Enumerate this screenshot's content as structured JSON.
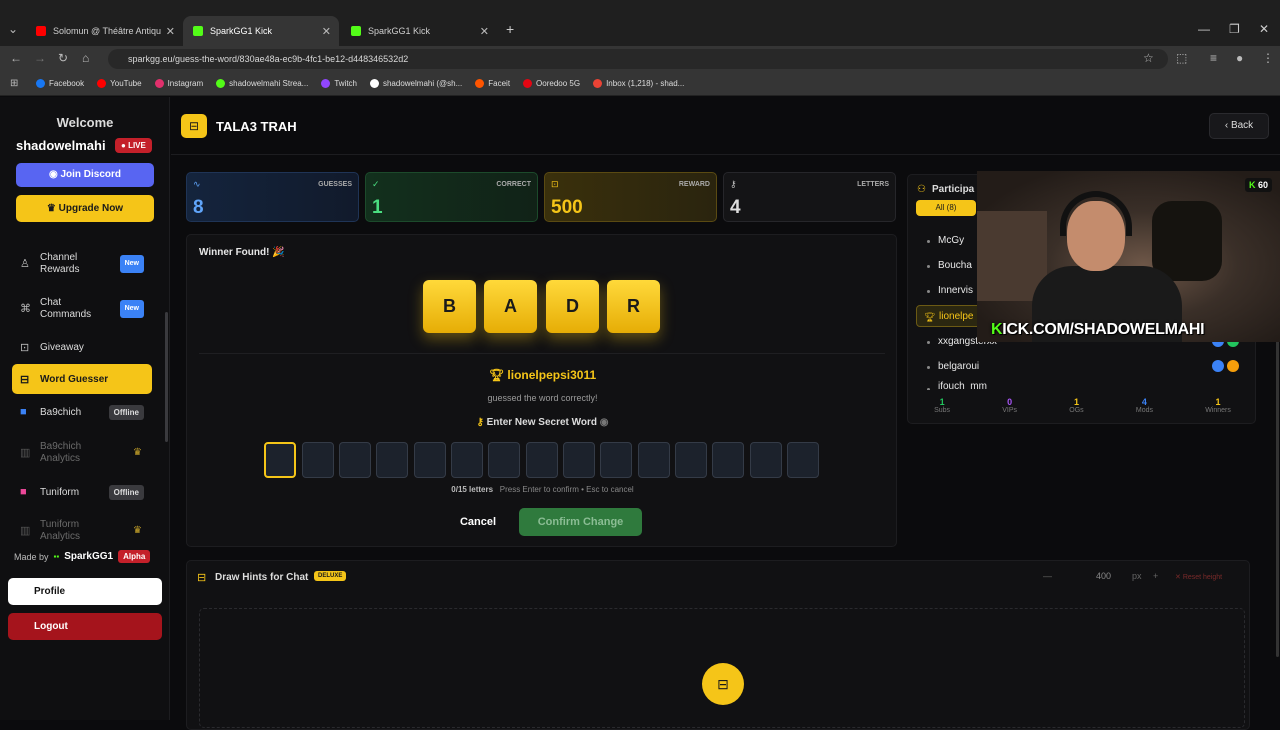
{
  "browser": {
    "tabs": [
      {
        "title": "Solomun @ Théâtre Antiqu"
      },
      {
        "title": "SparkGG1 Kick"
      },
      {
        "title": "SparkGG1 Kick"
      }
    ],
    "url": "sparkgg.eu/guess-the-word/830ae48a-ec9b-4fc1-be12-d448346532d2",
    "bookmarks": [
      {
        "label": "Facebook",
        "color": "#1877f2"
      },
      {
        "label": "YouTube",
        "color": "#ff0000"
      },
      {
        "label": "Instagram",
        "color": "#e1306c"
      },
      {
        "label": "shadowelmahi Strea...",
        "color": "#53fc18"
      },
      {
        "label": "Twitch",
        "color": "#9146ff"
      },
      {
        "label": "shadowelmahi (@sh...",
        "color": "#ffffff"
      },
      {
        "label": "Faceit",
        "color": "#ff5500"
      },
      {
        "label": "Ooredoo 5G",
        "color": "#e30613"
      },
      {
        "label": "Inbox (1,218) - shad...",
        "color": "#ea4335"
      }
    ]
  },
  "sidebar": {
    "welcome": "Welcome",
    "username": "shadowelmahi",
    "live_label": "LIVE",
    "discord_label": "Join Discord",
    "upgrade_label": "Upgrade Now",
    "items": [
      {
        "label": "Channel Rewards",
        "badge": "New"
      },
      {
        "label": "Chat Commands",
        "badge": "New"
      },
      {
        "label": "Giveaway"
      },
      {
        "label": "Word Guesser"
      },
      {
        "label": "Ba9chich",
        "badge": "Offline"
      },
      {
        "label": "Ba9chich Analytics"
      },
      {
        "label": "Tuniform",
        "badge": "Offline"
      },
      {
        "label": "Tuniform Analytics"
      }
    ],
    "made_by": "Made by",
    "brand": "SparkGG1",
    "alpha": "Alpha",
    "profile_label": "Profile",
    "logout_label": "Logout"
  },
  "header": {
    "title": "TALA3 TRAH",
    "back_label": "Back"
  },
  "stats": [
    {
      "label": "GUESSES",
      "value": "8"
    },
    {
      "label": "CORRECT",
      "value": "1"
    },
    {
      "label": "REWARD",
      "value": "500"
    },
    {
      "label": "LETTERS",
      "value": "4"
    }
  ],
  "game": {
    "winner_title": "Winner Found! 🎉",
    "letters": [
      "B",
      "A",
      "D",
      "R"
    ],
    "winner_name": "lionelpepsi3011",
    "guessed_text": "guessed the word correctly!",
    "enter_label": "Enter New Secret Word",
    "counter": "0/15 letters",
    "hint": "Press Enter to confirm • Esc to cancel",
    "cancel_label": "Cancel",
    "confirm_label": "Confirm Change"
  },
  "participants": {
    "title": "Participa",
    "filter_all": "All (8)",
    "list": [
      {
        "name": "McGy"
      },
      {
        "name": "Boucha"
      },
      {
        "name": "Innervis"
      },
      {
        "name": "lionelpe"
      },
      {
        "name": "xxgangsterxx"
      },
      {
        "name": "belgaroui"
      },
      {
        "name": "ifouch_mm"
      }
    ],
    "stats": [
      {
        "value": "1",
        "label": "Subs",
        "color": "#22c55e"
      },
      {
        "value": "0",
        "label": "VIPs",
        "color": "#a855f7"
      },
      {
        "value": "1",
        "label": "OGs",
        "color": "#f5c518"
      },
      {
        "value": "4",
        "label": "Mods",
        "color": "#3b82f6"
      },
      {
        "value": "1",
        "label": "Winners",
        "color": "#f5c518"
      }
    ]
  },
  "webcam": {
    "badge_count": "60",
    "overlay_k": "K",
    "overlay_text": "ICK.COM/SHADOWELMAHI"
  },
  "draw": {
    "title": "Draw Hints for Chat",
    "deluxe": "DELUXE",
    "height_value": "400",
    "unit": "px",
    "reset_label": "Reset height"
  }
}
